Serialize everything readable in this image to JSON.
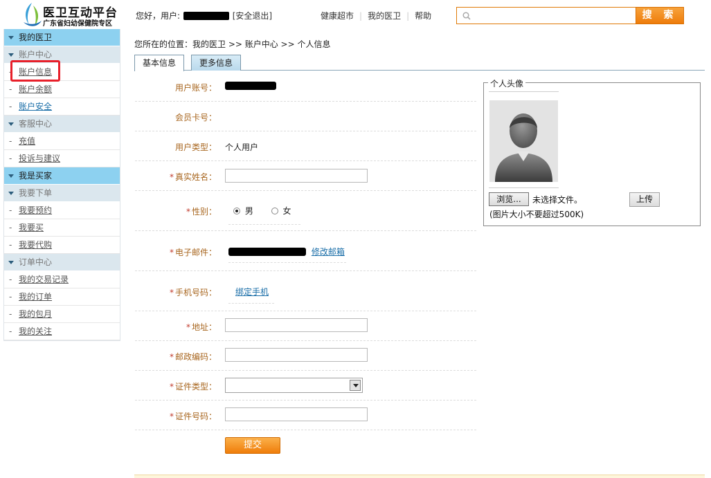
{
  "header": {
    "logo_title": "医卫互动平台",
    "logo_subtitle": "广东省妇幼保健院专区",
    "greeting_prefix": "您好，用户:",
    "logout_label": "[安全退出]",
    "nav": [
      "健康超市",
      "我的医卫",
      "帮助"
    ],
    "search_placeholder": "",
    "search_label": "搜 索"
  },
  "sidebar": {
    "sections": [
      {
        "type": "head",
        "label": "我的医卫"
      },
      {
        "type": "sub",
        "label": "账户中心"
      },
      {
        "type": "item",
        "label": "账户信息",
        "highlighted": true
      },
      {
        "type": "item",
        "label": "账户余额"
      },
      {
        "type": "item",
        "label": "账户安全",
        "active": true
      },
      {
        "type": "sub",
        "label": "客服中心"
      },
      {
        "type": "item",
        "label": "充值"
      },
      {
        "type": "item",
        "label": "投诉与建议"
      },
      {
        "type": "head",
        "label": "我是买家"
      },
      {
        "type": "sub",
        "label": "我要下单"
      },
      {
        "type": "item",
        "label": "我要预约"
      },
      {
        "type": "item",
        "label": "我要买"
      },
      {
        "type": "item",
        "label": "我要代购"
      },
      {
        "type": "sub",
        "label": "订单中心"
      },
      {
        "type": "item",
        "label": "我的交易记录"
      },
      {
        "type": "item",
        "label": "我的订单"
      },
      {
        "type": "item",
        "label": "我的包月"
      },
      {
        "type": "item",
        "label": "我的关注"
      }
    ]
  },
  "breadcrumb": "您所在的位置：我的医卫 >> 账户中心 >> 个人信息",
  "tabs": {
    "basic": "基本信息",
    "more": "更多信息"
  },
  "form": {
    "account_label": "用户账号：",
    "card_label": "会员卡号：",
    "card_value": "",
    "type_label": "用户类型：",
    "type_value": "个人用户",
    "realname_label": "真实姓名：",
    "gender_label": "性别：",
    "gender_male": "男",
    "gender_female": "女",
    "email_label": "电子邮件：",
    "email_edit": "修改邮箱",
    "phone_label": "手机号码：",
    "phone_bind": "绑定手机",
    "address_label": "地址：",
    "postcode_label": "邮政编码：",
    "idtype_label": "证件类型：",
    "idno_label": "证件号码：",
    "required_mark": "*",
    "submit_label": "提交"
  },
  "avatar": {
    "legend": "个人头像",
    "browse_label": "浏览...",
    "no_file": "未选择文件。",
    "upload_label": "上传",
    "size_hint": "(图片大小不要超过500K)"
  }
}
